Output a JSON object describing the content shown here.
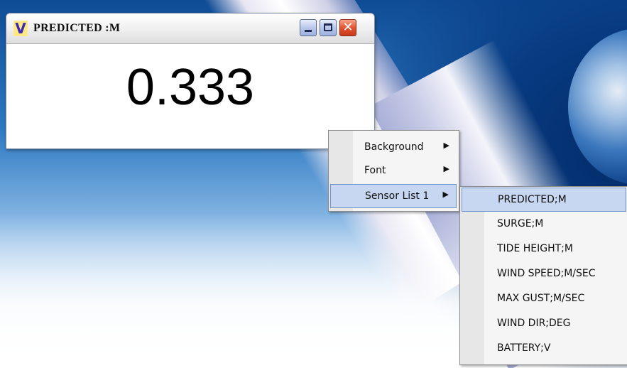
{
  "window": {
    "title": "PREDICTED :M",
    "app_icon_glyph": "V",
    "value": "0.333",
    "controls": [
      "minimize-icon",
      "maximize-icon",
      "close-icon"
    ],
    "close_glyph": "✕"
  },
  "context_menu": {
    "items": [
      {
        "label": "Background",
        "has_submenu": true
      },
      {
        "label": "Font",
        "has_submenu": true
      },
      {
        "label": "Sensor List 1",
        "has_submenu": true,
        "highlighted": true
      }
    ],
    "arrow_glyph": "▶"
  },
  "sensor_submenu": {
    "items": [
      {
        "label": "PREDICTED;M",
        "highlighted": true
      },
      {
        "label": "SURGE;M"
      },
      {
        "label": "TIDE HEIGHT;M"
      },
      {
        "label": "WIND SPEED;M/SEC"
      },
      {
        "label": "MAX GUST;M/SEC"
      },
      {
        "label": "WIND DIR;DEG"
      },
      {
        "label": "BATTERY;V"
      }
    ]
  },
  "colors": {
    "highlight": "#c7d7f1",
    "highlight_border": "#6f91c9",
    "close_button": "#e3542f"
  }
}
